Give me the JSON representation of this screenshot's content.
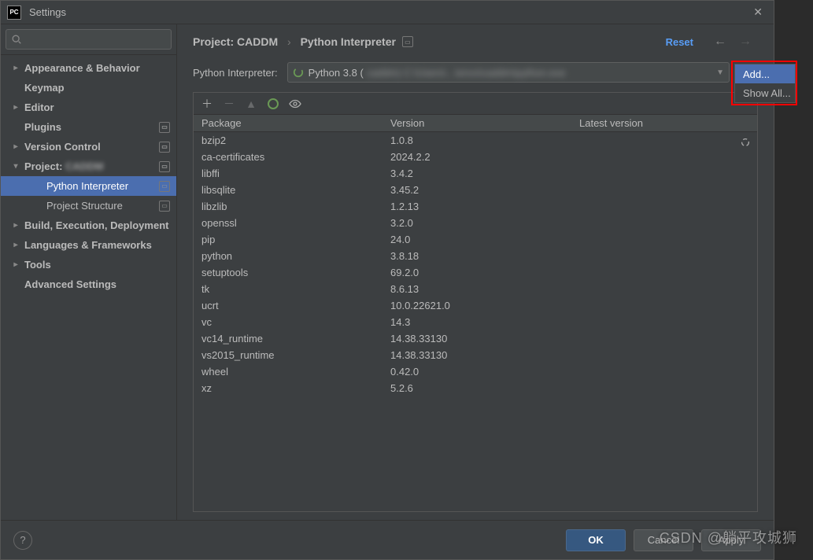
{
  "title": "Settings",
  "search_placeholder": "",
  "sidebar": {
    "items": [
      {
        "label": "Appearance & Behavior",
        "chev": "right",
        "bold": true,
        "badge": false
      },
      {
        "label": "Keymap",
        "chev": "none",
        "bold": true,
        "badge": false
      },
      {
        "label": "Editor",
        "chev": "right",
        "bold": true,
        "badge": false
      },
      {
        "label": "Plugins",
        "chev": "none",
        "bold": true,
        "badge": true
      },
      {
        "label": "Version Control",
        "chev": "right",
        "bold": true,
        "badge": true
      },
      {
        "label": "Project: ",
        "suffix_blur": "CADDM",
        "chev": "down",
        "bold": true,
        "badge": true
      },
      {
        "label": "Python Interpreter",
        "chev": "none",
        "child": true,
        "selected": true,
        "badge": true
      },
      {
        "label": "Project Structure",
        "chev": "none",
        "child": true,
        "badge": true
      },
      {
        "label": "Build, Execution, Deployment",
        "chev": "right",
        "bold": true,
        "badge": false
      },
      {
        "label": "Languages & Frameworks",
        "chev": "right",
        "bold": true,
        "badge": false
      },
      {
        "label": "Tools",
        "chev": "right",
        "bold": true,
        "badge": false
      },
      {
        "label": "Advanced Settings",
        "chev": "none",
        "bold": true,
        "badge": false
      }
    ]
  },
  "breadcrumb": {
    "project_label": "Project: CADDM",
    "page": "Python Interpreter"
  },
  "reset_label": "Reset",
  "interpreter": {
    "label": "Python Interpreter:",
    "value_prefix": "Python 3.8 (",
    "value_blur": "caddm) C:\\Users\\...\\envs\\caddm\\python.exe"
  },
  "menu": {
    "add": "Add...",
    "show_all": "Show All..."
  },
  "packages": {
    "headers": {
      "package": "Package",
      "version": "Version",
      "latest": "Latest version"
    },
    "rows": [
      {
        "name": "bzip2",
        "version": "1.0.8"
      },
      {
        "name": "ca-certificates",
        "version": "2024.2.2"
      },
      {
        "name": "libffi",
        "version": "3.4.2"
      },
      {
        "name": "libsqlite",
        "version": "3.45.2"
      },
      {
        "name": "libzlib",
        "version": "1.2.13"
      },
      {
        "name": "openssl",
        "version": "3.2.0"
      },
      {
        "name": "pip",
        "version": "24.0"
      },
      {
        "name": "python",
        "version": "3.8.18"
      },
      {
        "name": "setuptools",
        "version": "69.2.0"
      },
      {
        "name": "tk",
        "version": "8.6.13"
      },
      {
        "name": "ucrt",
        "version": "10.0.22621.0"
      },
      {
        "name": "vc",
        "version": "14.3"
      },
      {
        "name": "vc14_runtime",
        "version": "14.38.33130"
      },
      {
        "name": "vs2015_runtime",
        "version": "14.38.33130"
      },
      {
        "name": "wheel",
        "version": "0.42.0"
      },
      {
        "name": "xz",
        "version": "5.2.6"
      }
    ]
  },
  "footer": {
    "ok": "OK",
    "cancel": "Cancel",
    "apply": "Apply"
  },
  "watermark": "CSDN @躺平攻城狮"
}
